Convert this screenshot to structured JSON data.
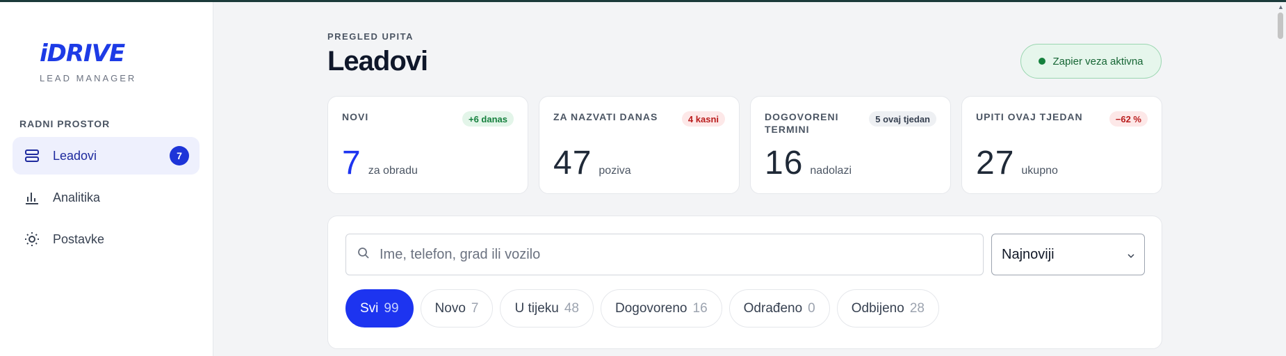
{
  "sidebar": {
    "logo": "iDRIVE",
    "logo_sub": "LEAD MANAGER",
    "section": "RADNI PROSTOR",
    "items": [
      {
        "label": "Leadovi",
        "badge": "7",
        "icon": "stack-icon",
        "active": true
      },
      {
        "label": "Analitika",
        "icon": "bar-chart-icon"
      },
      {
        "label": "Postavke",
        "icon": "sun-gear-icon"
      }
    ]
  },
  "header": {
    "eyebrow": "PREGLED UPITA",
    "title": "Leadovi",
    "status": "Zapier veza aktivna"
  },
  "stats": [
    {
      "label": "NOVI",
      "badge": "+6 danas",
      "value": "7",
      "unit": "za obradu"
    },
    {
      "label": "ZA NAZVATI DANAS",
      "badge": "4 kasni",
      "value": "47",
      "unit": "poziva"
    },
    {
      "label": "DOGOVORENI TERMINI",
      "badge": "5 ovaj tjedan",
      "value": "16",
      "unit": "nadolazi"
    },
    {
      "label": "UPITI OVAJ TJEDAN",
      "badge": "−62 %",
      "value": "27",
      "unit": "ukupno"
    }
  ],
  "filters": {
    "search_placeholder": "Ime, telefon, grad ili vozilo",
    "sort_selected": "Najnoviji",
    "chips": [
      {
        "label": "Svi",
        "count": "99"
      },
      {
        "label": "Novo",
        "count": "7"
      },
      {
        "label": "U tijeku",
        "count": "48"
      },
      {
        "label": "Dogovoreno",
        "count": "16"
      },
      {
        "label": "Odrađeno",
        "count": "0"
      },
      {
        "label": "Odbijeno",
        "count": "28"
      }
    ]
  },
  "colors": {
    "accent": "#1d34f0",
    "success": "#15803d",
    "badge_green_bg": "#e3f5e9",
    "badge_red_bg": "#fde8e8",
    "badge_gray_bg": "#eef0f3"
  }
}
